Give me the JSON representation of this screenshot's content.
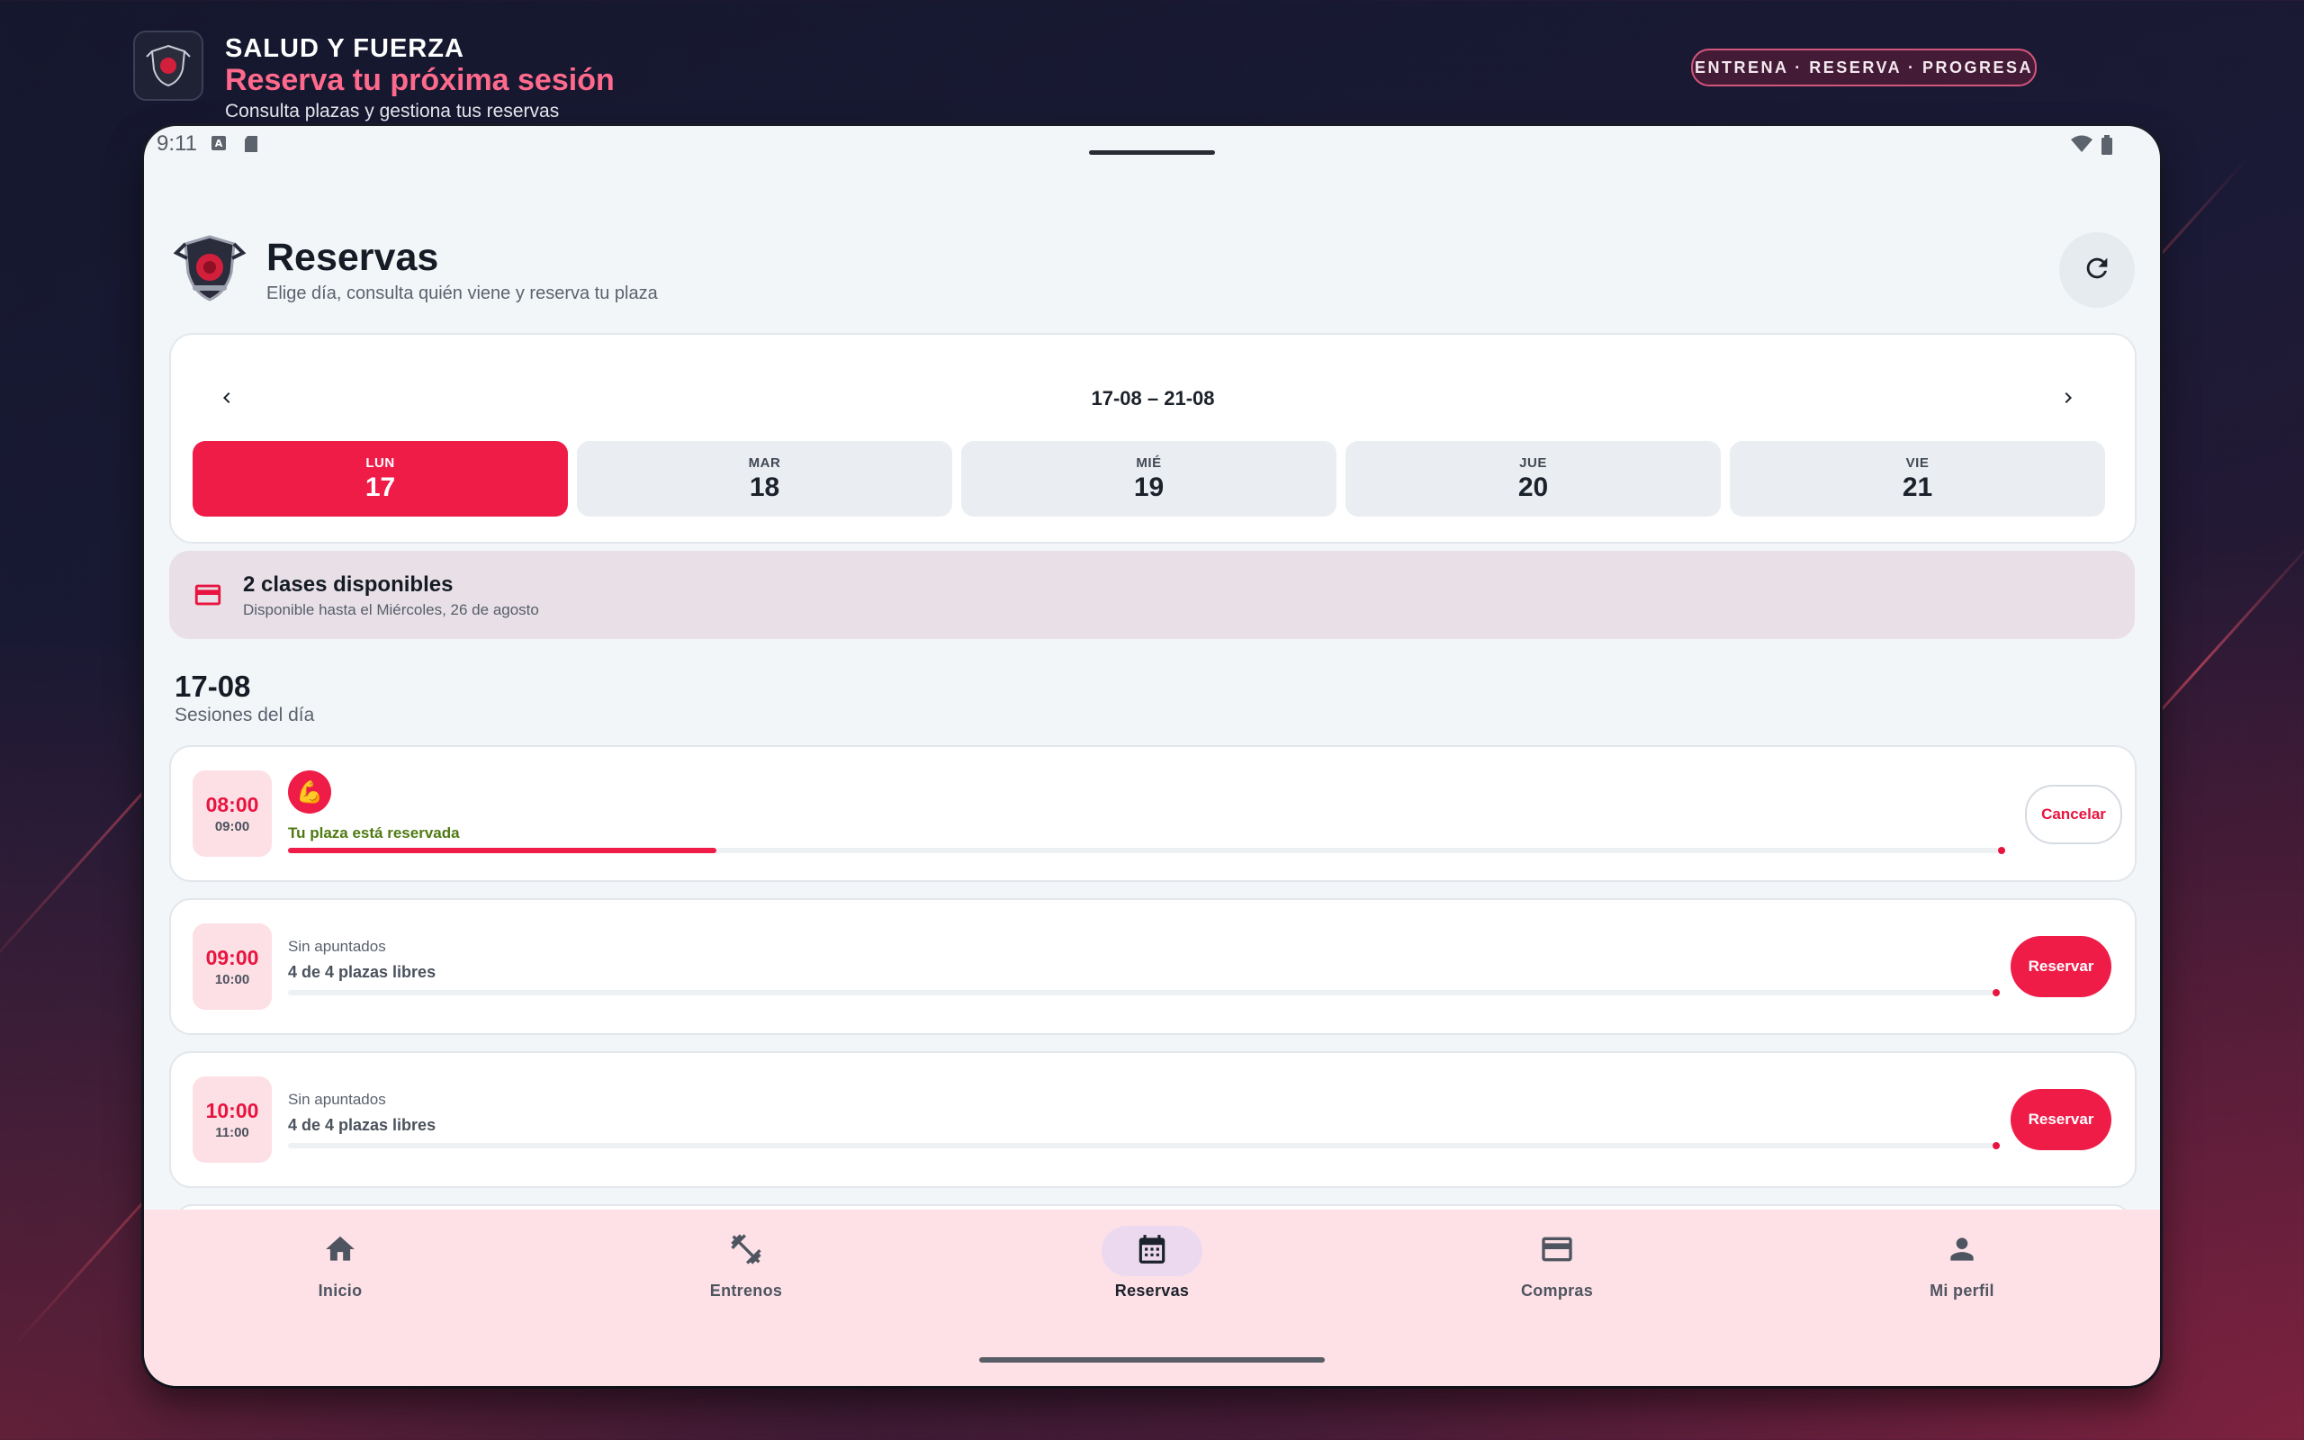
{
  "brand": {
    "name": "SALUD Y FUERZA",
    "title": "Reserva tu próxima sesión",
    "subtitle": "Consulta plazas y gestiona tus reservas",
    "tagline": "ENTRENA · RESERVA · PROGRESA"
  },
  "status_bar": {
    "time": "9:11"
  },
  "page": {
    "title": "Reservas",
    "subtitle": "Elige día, consulta quién viene y reserva tu plaza"
  },
  "week": {
    "range": "17-08 – 21-08",
    "days": [
      {
        "name": "LUN",
        "date": "17",
        "selected": true
      },
      {
        "name": "MAR",
        "date": "18",
        "selected": false
      },
      {
        "name": "MIÉ",
        "date": "19",
        "selected": false
      },
      {
        "name": "JUE",
        "date": "20",
        "selected": false
      },
      {
        "name": "VIE",
        "date": "21",
        "selected": false
      }
    ]
  },
  "credits": {
    "title": "2 clases disponibles",
    "subtitle": "Disponible hasta el Miércoles, 26 de agosto",
    "icon": "credit-card-icon"
  },
  "day_section": {
    "date": "17-08",
    "label": "Sesiones del día"
  },
  "sessions": [
    {
      "start": "08:00",
      "end": "09:00",
      "attendee_icon": "💪",
      "status": "Tu plaza está reservada",
      "occupancy": 0.25,
      "action": "Cancelar"
    },
    {
      "start": "09:00",
      "end": "10:00",
      "status": "Sin apuntados",
      "seats": "4 de 4 plazas libres",
      "occupancy": 0,
      "action": "Reservar"
    },
    {
      "start": "10:00",
      "end": "11:00",
      "status": "Sin apuntados",
      "seats": "4 de 4 plazas libres",
      "occupancy": 0,
      "action": "Reservar"
    }
  ],
  "bottom_nav": [
    {
      "label": "Inicio",
      "icon": "home-icon",
      "active": false
    },
    {
      "label": "Entrenos",
      "icon": "dumbbell-icon",
      "active": false
    },
    {
      "label": "Reservas",
      "icon": "calendar-icon",
      "active": true
    },
    {
      "label": "Compras",
      "icon": "credit-card-icon",
      "active": false
    },
    {
      "label": "Mi perfil",
      "icon": "person-icon",
      "active": false
    }
  ],
  "colors": {
    "accent": "#ef1c48",
    "reserved": "#4f7a12",
    "nav_bg": "#fde1e6"
  }
}
